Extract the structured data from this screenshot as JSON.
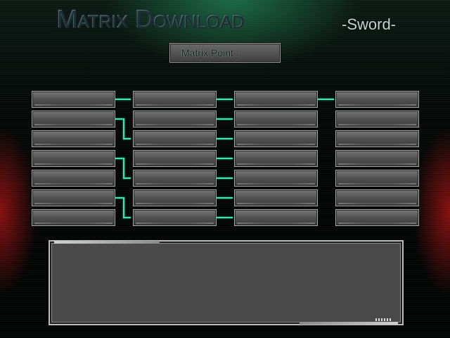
{
  "header": {
    "title": "Matrix Download",
    "subtitle": "-Sword-"
  },
  "matrix_point": {
    "label": "Matrix Point",
    "colon": ":",
    "value": ""
  },
  "slots": {
    "columns": 4,
    "rows_per_column": 7
  },
  "colors": {
    "accent": "#3fe6ad",
    "slot_fill": "#555555",
    "frame": "#bcbcbc"
  },
  "description": {
    "text": ""
  }
}
